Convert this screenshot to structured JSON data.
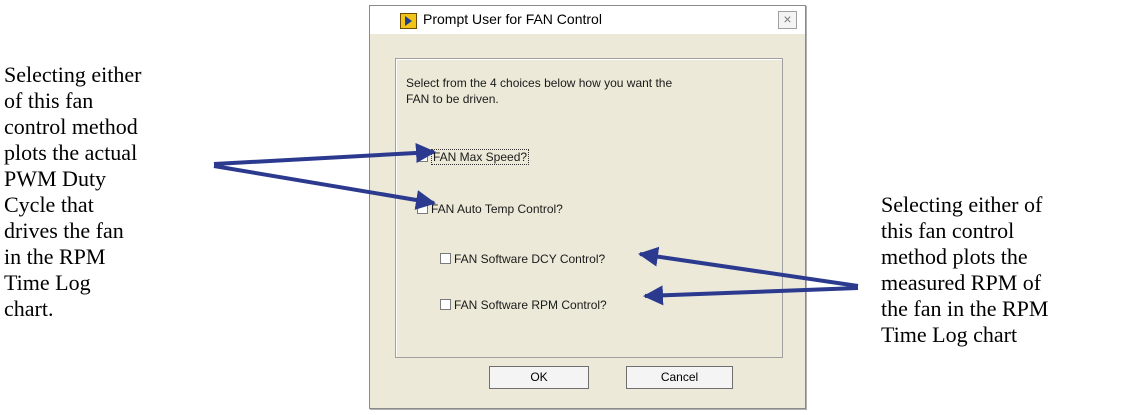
{
  "left_note": "Selecting either\nof this fan\ncontrol method\nplots the actual\nPWM Duty\nCycle that\ndrives the fan\nin the RPM\nTime Log\nchart.",
  "right_note": "Selecting either of\nthis fan control\nmethod plots the\nmeasured RPM of\nthe fan in the RPM\nTime Log chart",
  "dialog": {
    "title": "Prompt User for FAN Control",
    "close_label": "×",
    "prompt": "Select from the 4 choices below how you want the\nFAN to be driven.",
    "options": [
      {
        "label": "FAN Max Speed?",
        "checked": false
      },
      {
        "label": "FAN Auto Temp Control?",
        "checked": false
      },
      {
        "label": "FAN Software DCY Control?",
        "checked": false
      },
      {
        "label": "FAN Software RPM Control?",
        "checked": false
      }
    ],
    "ok_label": "OK",
    "cancel_label": "Cancel"
  },
  "colors": {
    "arrow": "#2b3a8f",
    "dialog_bg": "#ece9d8"
  }
}
